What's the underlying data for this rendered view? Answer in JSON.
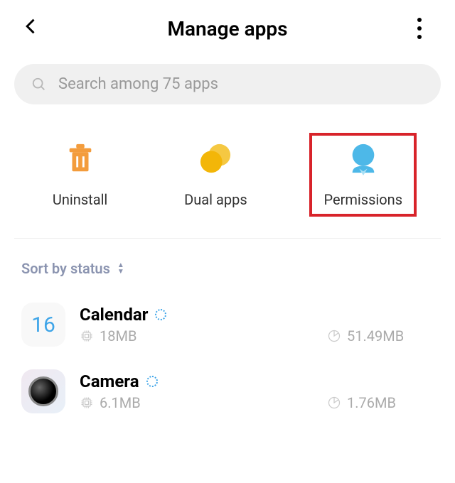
{
  "header": {
    "title": "Manage apps"
  },
  "search": {
    "placeholder": "Search among 75 apps"
  },
  "actions": {
    "uninstall": "Uninstall",
    "dualapps": "Dual apps",
    "permissions": "Permissions"
  },
  "sort": {
    "label": "Sort by status"
  },
  "apps": [
    {
      "name": "Calendar",
      "icon_text": "16",
      "app_size": "18MB",
      "storage": "51.49MB"
    },
    {
      "name": "Camera",
      "icon_text": "",
      "app_size": "6.1MB",
      "storage": "1.76MB"
    }
  ]
}
